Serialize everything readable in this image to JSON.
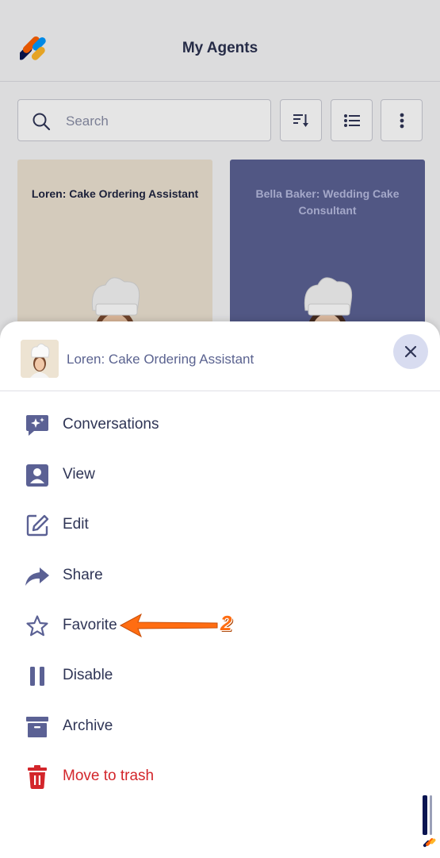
{
  "header": {
    "title": "My Agents"
  },
  "search": {
    "placeholder": "Search"
  },
  "cards": [
    {
      "title": "Loren: Cake Ordering Assistant",
      "bg": "#ede3d2",
      "fg": "#1f2440"
    },
    {
      "title": "Bella Baker: Wedding Cake Consultant",
      "bg": "#5b6194",
      "fg": "#b7bce0"
    }
  ],
  "sheet": {
    "title": "Loren: Cake Ordering Assistant",
    "items": [
      {
        "label": "Conversations",
        "icon": "conversations-sparkle-icon"
      },
      {
        "label": "View",
        "icon": "person-view-icon"
      },
      {
        "label": "Edit",
        "icon": "edit-pencil-icon"
      },
      {
        "label": "Share",
        "icon": "share-arrow-icon"
      },
      {
        "label": "Favorite",
        "icon": "star-outline-icon"
      },
      {
        "label": "Disable",
        "icon": "pause-icon"
      },
      {
        "label": "Archive",
        "icon": "archive-box-icon"
      },
      {
        "label": "Move to trash",
        "icon": "trash-icon"
      }
    ]
  },
  "annotation": {
    "step_number": "2"
  },
  "colors": {
    "accent": "#5b6194",
    "danger": "#d3262b",
    "callout": "#ff6d12"
  }
}
